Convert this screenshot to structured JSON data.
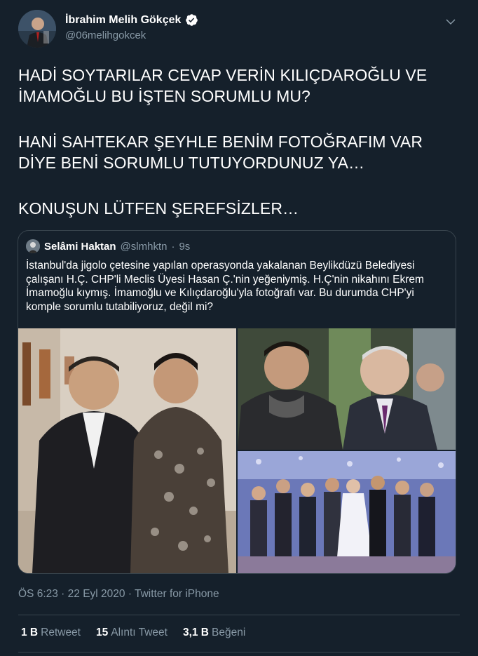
{
  "author": {
    "name": "İbrahim Melih Gökçek",
    "handle": "@06melihgokcek"
  },
  "tweet_text": {
    "p1": "HADİ SOYTARILAR CEVAP VERİN KILIÇDAROĞLU VE İMAMOĞLU BU İŞTEN SORUMLU MU?",
    "p2": "HANİ SAHTEKAR ŞEYHLE BENİM FOTOĞRAFIM VAR DİYE BENİ SORUMLU TUTUYORDUNUZ YA…",
    "p3": "KONUŞUN LÜTFEN ŞEREFSİZLER…"
  },
  "quoted": {
    "name": "Selâmi Haktan",
    "handle": "@slmhktn",
    "separator": "·",
    "time": "9s",
    "text": "İstanbul'da jigolo çetesine yapılan operasyonda yakalanan Beylikdüzü Belediyesi çalışanı H.Ç. CHP'li Meclis Üyesi Hasan Ç.'nin yeğeniymiş. H.Ç'nin nikahını Ekrem İmamoğlu kıymış. İmamoğlu ve Kılıçdaroğlu'yla fotoğrafı var. Bu durumda CHP'yi komple sorumlu tutabiliyoruz, değil mi?"
  },
  "timestamp": "ÖS 6:23 · 22 Eyl 2020 · Twitter for iPhone",
  "stats": {
    "retweets_count": "1 B",
    "retweets_label": "Retweet",
    "quotes_count": "15",
    "quotes_label": "Alıntı Tweet",
    "likes_count": "3,1 B",
    "likes_label": "Beğeni"
  },
  "colors": {
    "background": "#15202b",
    "border": "#38444d",
    "secondary_text": "#8899a6",
    "verified": "#ffffff"
  }
}
